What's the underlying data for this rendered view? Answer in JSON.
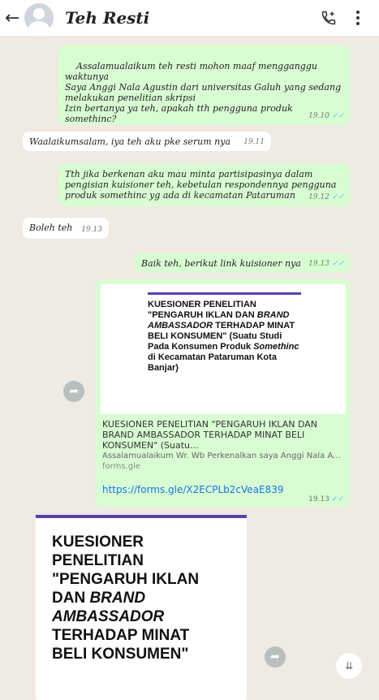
{
  "header": {
    "back_icon": "arrow-left-icon",
    "contact_name": "Teh Resti",
    "call_icon": "add-call-icon",
    "menu_icon": "more-vert-icon"
  },
  "messages": [
    {
      "type": "out",
      "text": "Assalamualaikum teh resti mohon maaf mengganggu waktunya\nSaya Anggi Nala Agustin dari universitas Galuh yang sedang melakukan penelitian skripsi\nIzin bertanya ya teh, apakah tth pengguna produk somethinc?",
      "time": "19.10"
    },
    {
      "type": "in",
      "text": "Waalaikumsalam, iya teh aku pke serum nya",
      "time": "19.11"
    },
    {
      "type": "out",
      "text": "Tth jika berkenan aku mau minta partisipasinya dalam pengisian kuisioner teh, kebetulan respondennya pengguna produk somethinc yg ada di kecamatan Pataruman",
      "time": "19.12"
    },
    {
      "type": "in",
      "text": "Boleh teh",
      "time": "19.13"
    },
    {
      "type": "out",
      "text": "Baik teh, berikut link kuisioner nya",
      "time": "19.13"
    }
  ],
  "link_message": {
    "image_title_line1": "KUESIONER PENELITIAN \"PENGARUH IKLAN DAN ",
    "image_title_italic1": "BRAND AMBASSADOR",
    "image_title_line2": " TERHADAP MINAT BELI KONSUMEN\" (Suatu Studi Pada Konsumen Produk ",
    "image_title_italic2": "Somethinc",
    "image_title_line3": " di Kecamatan Pataruman Kota Banjar)",
    "preview_title": "KUESIONER PENELITIAN \"PENGARUH IKLAN DAN BRAND AMBASSADOR TERHADAP MINAT BELI KONSUMEN\" (Suatu...",
    "preview_desc": "Assalamualaikum Wr. Wb Perkenalkan saya Anggi Nala A...",
    "preview_domain": "forms.gle",
    "url": "https://forms.gle/X2ECPLb2cVeaE839",
    "time": "19.13"
  },
  "doc_message": {
    "title_lines": [
      "KUESIONER",
      "PENELITIAN",
      "\"PENGARUH IKLAN",
      "DAN ",
      "AMBASSADOR",
      "TERHADAP MINAT",
      "BELI KONSUMEN\""
    ],
    "italic_word": "BRAND"
  }
}
